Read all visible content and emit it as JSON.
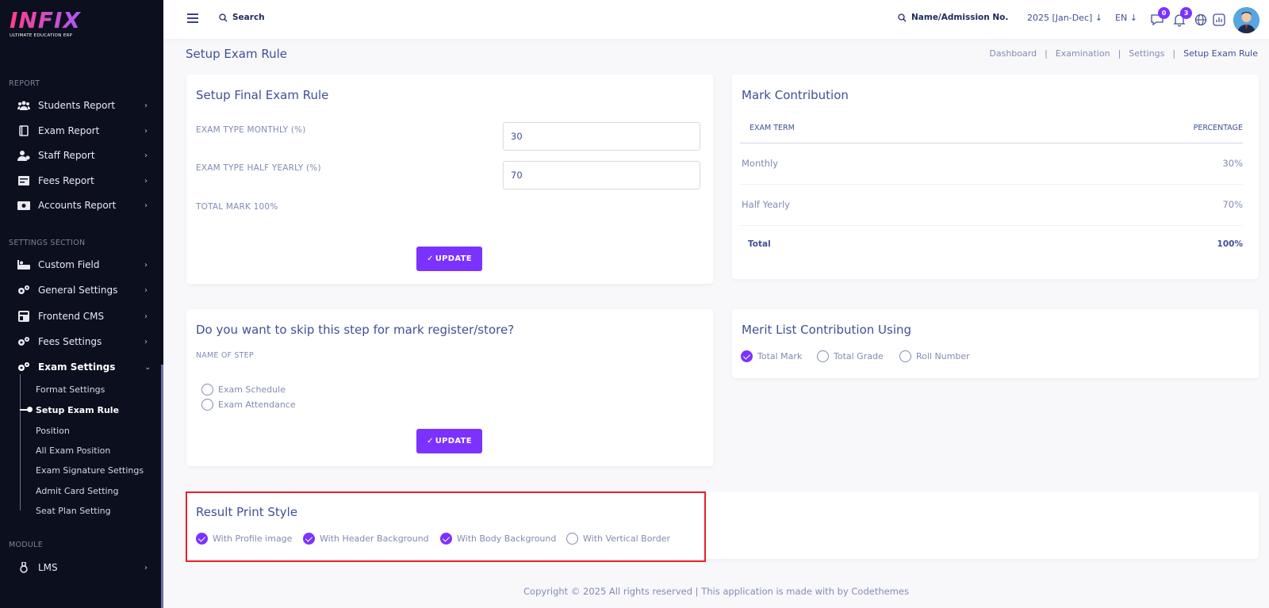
{
  "brand": {
    "logo": "INFIX",
    "tagline": "ULTIMATE EDUCATION ERP"
  },
  "sidebar": {
    "sections": {
      "report": "REPORT",
      "settings": "SETTINGS SECTION",
      "module": "MODULE"
    },
    "report_items": [
      {
        "label": "Students Report",
        "icon": "users-icon"
      },
      {
        "label": "Exam Report",
        "icon": "book-icon"
      },
      {
        "label": "Staff Report",
        "icon": "staff-icon"
      },
      {
        "label": "Fees Report",
        "icon": "fees-icon"
      },
      {
        "label": "Accounts Report",
        "icon": "money-icon"
      }
    ],
    "settings_items": [
      {
        "label": "Custom Field",
        "icon": "field-icon"
      },
      {
        "label": "General Settings",
        "icon": "gears-icon"
      },
      {
        "label": "Frontend CMS",
        "icon": "cms-icon"
      },
      {
        "label": "Fees Settings",
        "icon": "gears-icon"
      },
      {
        "label": "Exam Settings",
        "icon": "gears-icon"
      }
    ],
    "exam_sub_items": [
      "Format Settings",
      "Setup Exam Rule",
      "Position",
      "All Exam Position",
      "Exam Signature Settings",
      "Admit Card Setting",
      "Seat Plan Setting"
    ],
    "module_items": [
      {
        "label": "LMS",
        "icon": "lms-icon"
      }
    ]
  },
  "topbar": {
    "search_placeholder": "Search",
    "admission_placeholder": "Name/Admission No.",
    "year": "2025 [Jan-Dec]",
    "lang": "EN",
    "messages_count": "0",
    "notifications_count": "3"
  },
  "breadcrumb": {
    "title": "Setup Exam Rule",
    "items": [
      "Dashboard",
      "Examination",
      "Settings",
      "Setup Exam Rule"
    ],
    "separator": "|"
  },
  "final_rule": {
    "title": "Setup Final Exam Rule",
    "monthly_label": "EXAM TYPE MONTHLY (%)",
    "monthly_value": "30",
    "half_yearly_label": "EXAM TYPE HALF YEARLY (%)",
    "half_yearly_value": "70",
    "total_label": "TOTAL MARK 100%",
    "update_label": "UPDATE"
  },
  "mark_contribution": {
    "title": "Mark Contribution",
    "headers": [
      "EXAM TERM",
      "PERCENTAGE"
    ],
    "rows": [
      [
        "Monthly",
        "30%"
      ],
      [
        "Half Yearly",
        "70%"
      ]
    ],
    "total": [
      "Total",
      "100%"
    ]
  },
  "skip_step": {
    "title": "Do you want to skip this step for mark register/store?",
    "label": "NAME OF STEP",
    "options": [
      "Exam Schedule",
      "Exam Attendance"
    ],
    "update_label": "UPDATE"
  },
  "merit_list": {
    "title": "Merit List Contribution Using",
    "options": [
      "Total Mark",
      "Total Grade",
      "Roll Number"
    ],
    "selected": 0
  },
  "print_style": {
    "title": "Result Print Style",
    "options": [
      "With Profile image",
      "With Header Background",
      "With Body Background",
      "With Vertical Border"
    ],
    "checked": [
      true,
      true,
      true,
      false
    ]
  },
  "footer": {
    "text": "Copyright © 2025 All rights reserved | This application is made with by Codethemes"
  },
  "colors": {
    "accent": "#7c32ff",
    "sidebar_bg": "#0b0f1e",
    "text": "#415094",
    "muted": "#828bb2",
    "highlight": "#e8202a"
  }
}
